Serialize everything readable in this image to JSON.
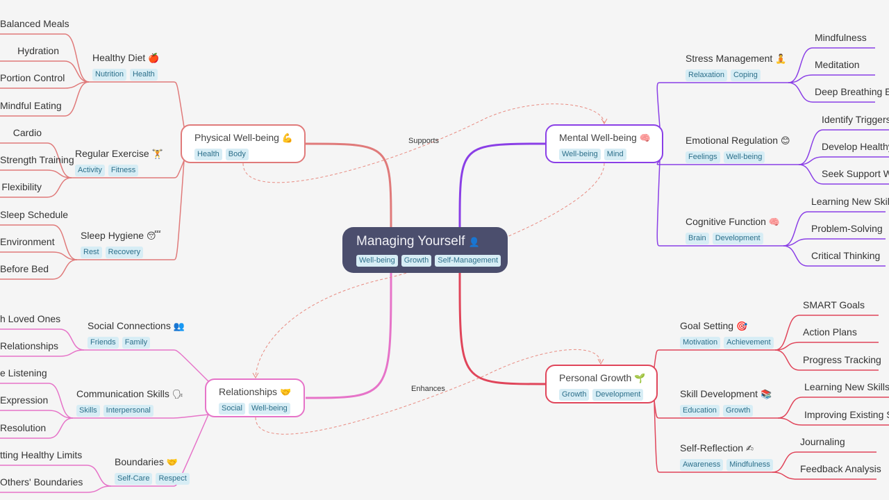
{
  "root": {
    "title": "Managing Yourself",
    "icon": "👤",
    "tags": [
      "Well-being",
      "Growth",
      "Self-Management"
    ]
  },
  "colors": {
    "physical": "#e07a7a",
    "mental": "#8a3fe6",
    "relationships": "#e673c8",
    "growth": "#e0455a",
    "root_bg": "#4b4e6d",
    "link": "#e88a80"
  },
  "branches": {
    "physical": {
      "title": "Physical Well-being",
      "icon": "💪",
      "tags": [
        "Health",
        "Body"
      ],
      "subs": [
        {
          "title": "Healthy Diet",
          "icon": "🍎",
          "tags": [
            "Nutrition",
            "Health"
          ],
          "leaves": [
            "Balanced Meals",
            "Hydration",
            "Portion Control",
            "Mindful Eating"
          ]
        },
        {
          "title": "Regular Exercise",
          "icon": "🏋",
          "tags": [
            "Activity",
            "Fitness"
          ],
          "leaves": [
            "Cardio",
            "Strength Training",
            "Flexibility"
          ]
        },
        {
          "title": "Sleep Hygiene",
          "icon": "😴",
          "tags": [
            "Rest",
            "Recovery"
          ],
          "leaves": [
            "Sleep Schedule",
            "Environment",
            "Before Bed"
          ]
        }
      ]
    },
    "mental": {
      "title": "Mental Well-being",
      "icon": "🧠",
      "tags": [
        "Well-being",
        "Mind"
      ],
      "subs": [
        {
          "title": "Stress Management",
          "icon": "🧘",
          "tags": [
            "Relaxation",
            "Coping"
          ],
          "leaves": [
            "Mindfulness",
            "Meditation",
            "Deep Breathing Ex"
          ]
        },
        {
          "title": "Emotional Regulation",
          "icon": "😊",
          "tags": [
            "Feelings",
            "Well-being"
          ],
          "leaves": [
            "Identify Triggers",
            "Develop Healthy",
            "Seek Support W"
          ]
        },
        {
          "title": "Cognitive Function",
          "icon": "🧠",
          "tags": [
            "Brain",
            "Development"
          ],
          "leaves": [
            "Learning New Skill",
            "Problem-Solving",
            "Critical Thinking"
          ]
        }
      ]
    },
    "relationships": {
      "title": "Relationships",
      "icon": "🤝",
      "tags": [
        "Social",
        "Well-being"
      ],
      "subs": [
        {
          "title": "Social Connections",
          "icon": "👥",
          "tags": [
            "Friends",
            "Family"
          ],
          "leaves": [
            "h Loved Ones",
            "Relationships"
          ]
        },
        {
          "title": "Communication Skills",
          "icon": "🗣",
          "tags": [
            "Skills",
            "Interpersonal"
          ],
          "leaves": [
            "e Listening",
            "Expression",
            "Resolution"
          ]
        },
        {
          "title": "Boundaries",
          "icon": "🤝",
          "tags": [
            "Self-Care",
            "Respect"
          ],
          "leaves": [
            "tting Healthy Limits",
            "Others' Boundaries"
          ]
        }
      ]
    },
    "growth": {
      "title": "Personal Growth",
      "icon": "🌱",
      "tags": [
        "Growth",
        "Development"
      ],
      "subs": [
        {
          "title": "Goal Setting",
          "icon": "🎯",
          "tags": [
            "Motivation",
            "Achievement"
          ],
          "leaves": [
            "SMART Goals",
            "Action Plans",
            "Progress Tracking"
          ]
        },
        {
          "title": "Skill Development",
          "icon": "📚",
          "tags": [
            "Education",
            "Growth"
          ],
          "leaves": [
            "Learning New Skills",
            "Improving Existing S"
          ]
        },
        {
          "title": "Self-Reflection",
          "icon": "✍",
          "tags": [
            "Awareness",
            "Mindfulness"
          ],
          "leaves": [
            "Journaling",
            "Feedback Analysis"
          ]
        }
      ]
    }
  },
  "relations": [
    {
      "label": "Supports",
      "from": "Physical Well-being",
      "to": "Mental Well-being"
    },
    {
      "label": "Enhances",
      "from": "Relationships",
      "to": "Personal Growth"
    },
    {
      "label": "",
      "from": "Mental Well-being",
      "to": "Relationships"
    }
  ]
}
